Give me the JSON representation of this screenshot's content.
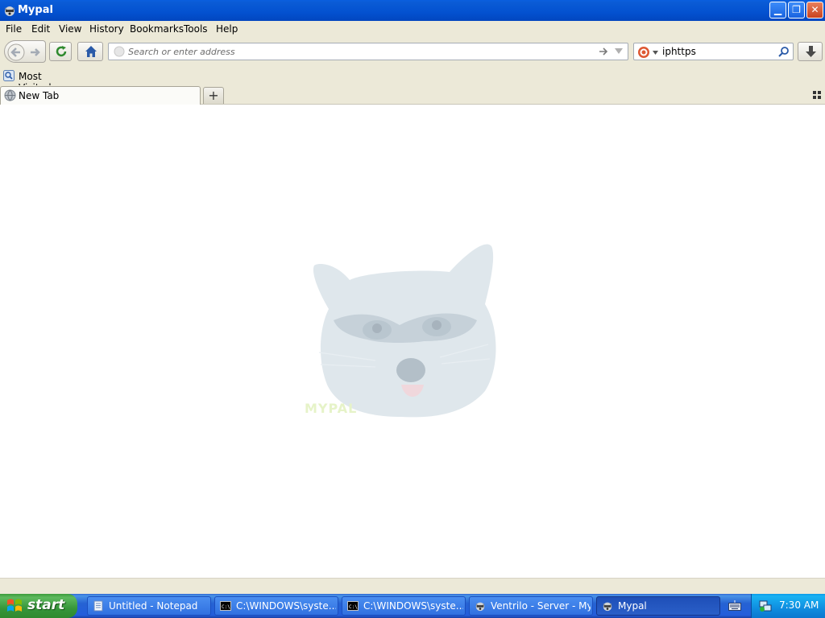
{
  "window": {
    "title": "Mypal"
  },
  "menu": {
    "items": [
      "File",
      "Edit",
      "View",
      "History",
      "Bookmarks",
      "Tools",
      "Help"
    ]
  },
  "urlbar": {
    "placeholder": "Search or enter address"
  },
  "search": {
    "value": "iphttps"
  },
  "bookmarks": {
    "items": [
      {
        "label": "Most Visited"
      }
    ]
  },
  "tabs": [
    {
      "label": "New Tab",
      "active": true
    }
  ],
  "content": {
    "logo_text": "MYPAL"
  },
  "taskbar": {
    "start_label": "start",
    "tasks": [
      {
        "label": "Untitled - Notepad",
        "icon": "notepad-icon",
        "active": false
      },
      {
        "label": "C:\\WINDOWS\\syste...",
        "icon": "cmd-icon",
        "active": false
      },
      {
        "label": "C:\\WINDOWS\\syste...",
        "icon": "cmd-icon",
        "active": false
      },
      {
        "label": "Ventrilo - Server - My...",
        "icon": "raccoon-icon",
        "active": false
      },
      {
        "label": "Mypal",
        "icon": "raccoon-icon",
        "active": true
      }
    ],
    "clock": "7:30 AM"
  },
  "colors": {
    "titlebar": "#0351d0",
    "chrome": "#ece9d8",
    "taskbar": "#245edb",
    "start": "#36963a",
    "tray": "#0f8ddf"
  }
}
